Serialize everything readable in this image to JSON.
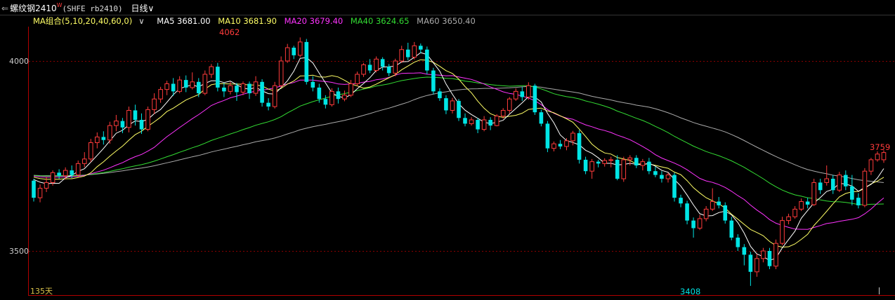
{
  "header": {
    "menu_icon": "⇐",
    "symbol_name": "螺纹钢2410",
    "badge": "W",
    "code": "(SHFE rb2410)",
    "period": "日线",
    "period_arrow": "∨"
  },
  "ma_legend": {
    "group_label": "MA组合(5,10,20,40,60,0)",
    "group_arrow": "∨",
    "items": [
      {
        "label": "MA5 3681.00",
        "color": "#ffffff"
      },
      {
        "label": "MA10 3681.90",
        "color": "#ffff66"
      },
      {
        "label": "MA20 3679.40",
        "color": "#ff33ff"
      },
      {
        "label": "MA40 3624.65",
        "color": "#33dd33"
      },
      {
        "label": "MA60 3650.40",
        "color": "#aaaaaa"
      }
    ]
  },
  "colors": {
    "up": "#ff3b3b",
    "down": "#00e5e5",
    "grid": "#8b0000",
    "axis": "#b00000"
  },
  "footer": {
    "days_label": "135天"
  },
  "chart_data": {
    "type": "candlestick",
    "y_ticks": [
      4000,
      3500
    ],
    "ylim": [
      3383,
      4105
    ],
    "high_label": "4062",
    "low_label": "3408",
    "last_label": "3759",
    "bar_count": 135,
    "candles": [
      [
        3685,
        3640,
        3690,
        3630
      ],
      [
        3640,
        3665,
        3675,
        3628
      ],
      [
        3665,
        3680,
        3695,
        3655
      ],
      [
        3680,
        3706,
        3712,
        3672
      ],
      [
        3706,
        3698,
        3715,
        3690
      ],
      [
        3698,
        3712,
        3720,
        3688
      ],
      [
        3712,
        3700,
        3725,
        3692
      ],
      [
        3700,
        3730,
        3738,
        3694
      ],
      [
        3730,
        3742,
        3760,
        3720
      ],
      [
        3742,
        3785,
        3795,
        3734
      ],
      [
        3785,
        3800,
        3812,
        3770
      ],
      [
        3800,
        3792,
        3815,
        3780
      ],
      [
        3792,
        3830,
        3840,
        3782
      ],
      [
        3830,
        3842,
        3858,
        3815
      ],
      [
        3842,
        3825,
        3850,
        3810
      ],
      [
        3825,
        3870,
        3880,
        3812
      ],
      [
        3870,
        3845,
        3885,
        3830
      ],
      [
        3845,
        3820,
        3862,
        3808
      ],
      [
        3820,
        3872,
        3880,
        3815
      ],
      [
        3872,
        3900,
        3915,
        3860
      ],
      [
        3900,
        3925,
        3932,
        3890
      ],
      [
        3925,
        3940,
        3948,
        3910
      ],
      [
        3940,
        3920,
        3955,
        3908
      ],
      [
        3920,
        3950,
        3960,
        3915
      ],
      [
        3950,
        3930,
        3962,
        3918
      ],
      [
        3930,
        3945,
        3970,
        3925
      ],
      [
        3945,
        3915,
        3955,
        3905
      ],
      [
        3915,
        3965,
        3975,
        3910
      ],
      [
        3965,
        3985,
        3992,
        3955
      ],
      [
        3985,
        3930,
        3995,
        3920
      ],
      [
        3930,
        3920,
        3942,
        3905
      ],
      [
        3920,
        3935,
        3945,
        3912
      ],
      [
        3935,
        3918,
        3942,
        3895
      ],
      [
        3918,
        3940,
        3946,
        3910
      ],
      [
        3940,
        3915,
        3946,
        3900
      ],
      [
        3915,
        3945,
        3960,
        3908
      ],
      [
        3945,
        3890,
        3952,
        3880
      ],
      [
        3890,
        3880,
        3902,
        3870
      ],
      [
        3880,
        3935,
        3945,
        3875
      ],
      [
        3935,
        4000,
        4012,
        3930
      ],
      [
        4000,
        4035,
        4045,
        3995
      ],
      [
        4035,
        4015,
        4040,
        4005
      ],
      [
        4015,
        4050,
        4062,
        4010
      ],
      [
        4050,
        3945,
        4058,
        3938
      ],
      [
        3945,
        3930,
        3960,
        3920
      ],
      [
        3930,
        3900,
        3940,
        3890
      ],
      [
        3900,
        3885,
        3910,
        3875
      ],
      [
        3885,
        3920,
        3928,
        3880
      ],
      [
        3920,
        3900,
        3930,
        3888
      ],
      [
        3900,
        3910,
        3922,
        3894
      ],
      [
        3910,
        3940,
        3950,
        3905
      ],
      [
        3940,
        3965,
        3972,
        3934
      ],
      [
        3965,
        3990,
        3995,
        3958
      ],
      [
        3990,
        3975,
        4005,
        3968
      ],
      [
        3975,
        4005,
        4012,
        3970
      ],
      [
        4005,
        3985,
        4010,
        3975
      ],
      [
        3985,
        3968,
        3992,
        3960
      ],
      [
        3968,
        4000,
        4006,
        3960
      ],
      [
        4000,
        4030,
        4040,
        3995
      ],
      [
        4030,
        4010,
        4048,
        4002
      ],
      [
        4010,
        4040,
        4050,
        4004
      ],
      [
        4040,
        4030,
        4046,
        4020
      ],
      [
        4030,
        3975,
        4038,
        3965
      ],
      [
        3975,
        3920,
        3982,
        3912
      ],
      [
        3920,
        3902,
        3928,
        3895
      ],
      [
        3902,
        3870,
        3910,
        3860
      ],
      [
        3870,
        3895,
        3903,
        3862
      ],
      [
        3895,
        3850,
        3900,
        3842
      ],
      [
        3850,
        3835,
        3862,
        3828
      ],
      [
        3835,
        3845,
        3852,
        3830
      ],
      [
        3845,
        3820,
        3850,
        3810
      ],
      [
        3820,
        3845,
        3855,
        3815
      ],
      [
        3845,
        3830,
        3852,
        3818
      ],
      [
        3830,
        3855,
        3860,
        3828
      ],
      [
        3855,
        3870,
        3876,
        3848
      ],
      [
        3870,
        3900,
        3905,
        3862
      ],
      [
        3900,
        3920,
        3928,
        3895
      ],
      [
        3920,
        3905,
        3932,
        3895
      ],
      [
        3905,
        3935,
        3944,
        3898
      ],
      [
        3935,
        3865,
        3940,
        3858
      ],
      [
        3865,
        3835,
        3872,
        3828
      ],
      [
        3835,
        3770,
        3842,
        3760
      ],
      [
        3770,
        3782,
        3788,
        3762
      ],
      [
        3782,
        3775,
        3792,
        3768
      ],
      [
        3775,
        3790,
        3797,
        3765
      ],
      [
        3790,
        3810,
        3816,
        3778
      ],
      [
        3810,
        3740,
        3818,
        3730
      ],
      [
        3740,
        3710,
        3748,
        3702
      ],
      [
        3710,
        3735,
        3742,
        3690
      ],
      [
        3735,
        3730,
        3740,
        3720
      ],
      [
        3730,
        3738,
        3744,
        3722
      ],
      [
        3738,
        3740,
        3748,
        3720
      ],
      [
        3740,
        3690,
        3752,
        3686
      ],
      [
        3690,
        3740,
        3748,
        3682
      ],
      [
        3740,
        3745,
        3752,
        3725
      ],
      [
        3745,
        3725,
        3752,
        3718
      ],
      [
        3725,
        3735,
        3742,
        3712
      ],
      [
        3735,
        3710,
        3745,
        3702
      ],
      [
        3710,
        3700,
        3722,
        3694
      ],
      [
        3700,
        3690,
        3710,
        3680
      ],
      [
        3690,
        3700,
        3706,
        3680
      ],
      [
        3700,
        3640,
        3706,
        3630
      ],
      [
        3640,
        3625,
        3648,
        3615
      ],
      [
        3625,
        3580,
        3632,
        3570
      ],
      [
        3580,
        3560,
        3588,
        3535
      ],
      [
        3560,
        3585,
        3595,
        3555
      ],
      [
        3585,
        3610,
        3618,
        3578
      ],
      [
        3610,
        3630,
        3665,
        3605
      ],
      [
        3630,
        3620,
        3642,
        3612
      ],
      [
        3620,
        3580,
        3628,
        3572
      ],
      [
        3580,
        3535,
        3590,
        3528
      ],
      [
        3535,
        3510,
        3544,
        3500
      ],
      [
        3510,
        3490,
        3518,
        3462
      ],
      [
        3490,
        3445,
        3498,
        3408
      ],
      [
        3445,
        3480,
        3492,
        3432
      ],
      [
        3480,
        3500,
        3508,
        3470
      ],
      [
        3500,
        3460,
        3508,
        3452
      ],
      [
        3460,
        3520,
        3530,
        3452
      ],
      [
        3520,
        3580,
        3590,
        3515
      ],
      [
        3580,
        3590,
        3598,
        3570
      ],
      [
        3590,
        3610,
        3618,
        3585
      ],
      [
        3610,
        3630,
        3638,
        3605
      ],
      [
        3630,
        3622,
        3640,
        3612
      ],
      [
        3622,
        3680,
        3690,
        3618
      ],
      [
        3680,
        3660,
        3690,
        3650
      ],
      [
        3680,
        3690,
        3725,
        3672
      ],
      [
        3690,
        3660,
        3700,
        3650
      ],
      [
        3660,
        3700,
        3708,
        3655
      ],
      [
        3700,
        3670,
        3712,
        3660
      ],
      [
        3670,
        3635,
        3700,
        3620
      ],
      [
        3640,
        3620,
        3652,
        3612
      ],
      [
        3620,
        3710,
        3718,
        3615
      ],
      [
        3710,
        3740,
        3745,
        3700
      ],
      [
        3740,
        3755,
        3762,
        3735
      ],
      [
        3740,
        3759,
        3765,
        3732
      ]
    ]
  }
}
